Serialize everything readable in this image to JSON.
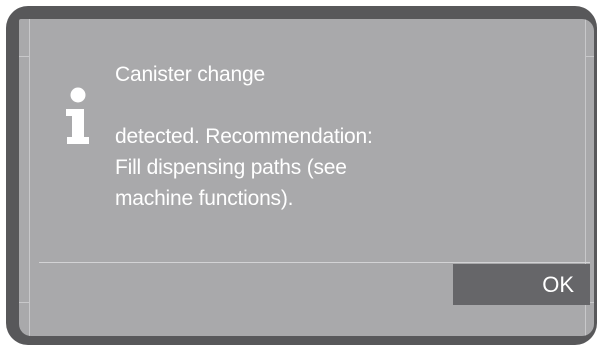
{
  "dialog": {
    "icon": "info-icon",
    "message_lines": [
      "Canister change",
      "detected. Recommendation:",
      "Fill dispensing paths (see",
      "machine functions)."
    ]
  },
  "buttons": {
    "ok_label": "OK"
  },
  "colors": {
    "bezel": "#58585a",
    "screen": "#a9a9ab",
    "button": "#666669",
    "text": "#ffffff"
  }
}
